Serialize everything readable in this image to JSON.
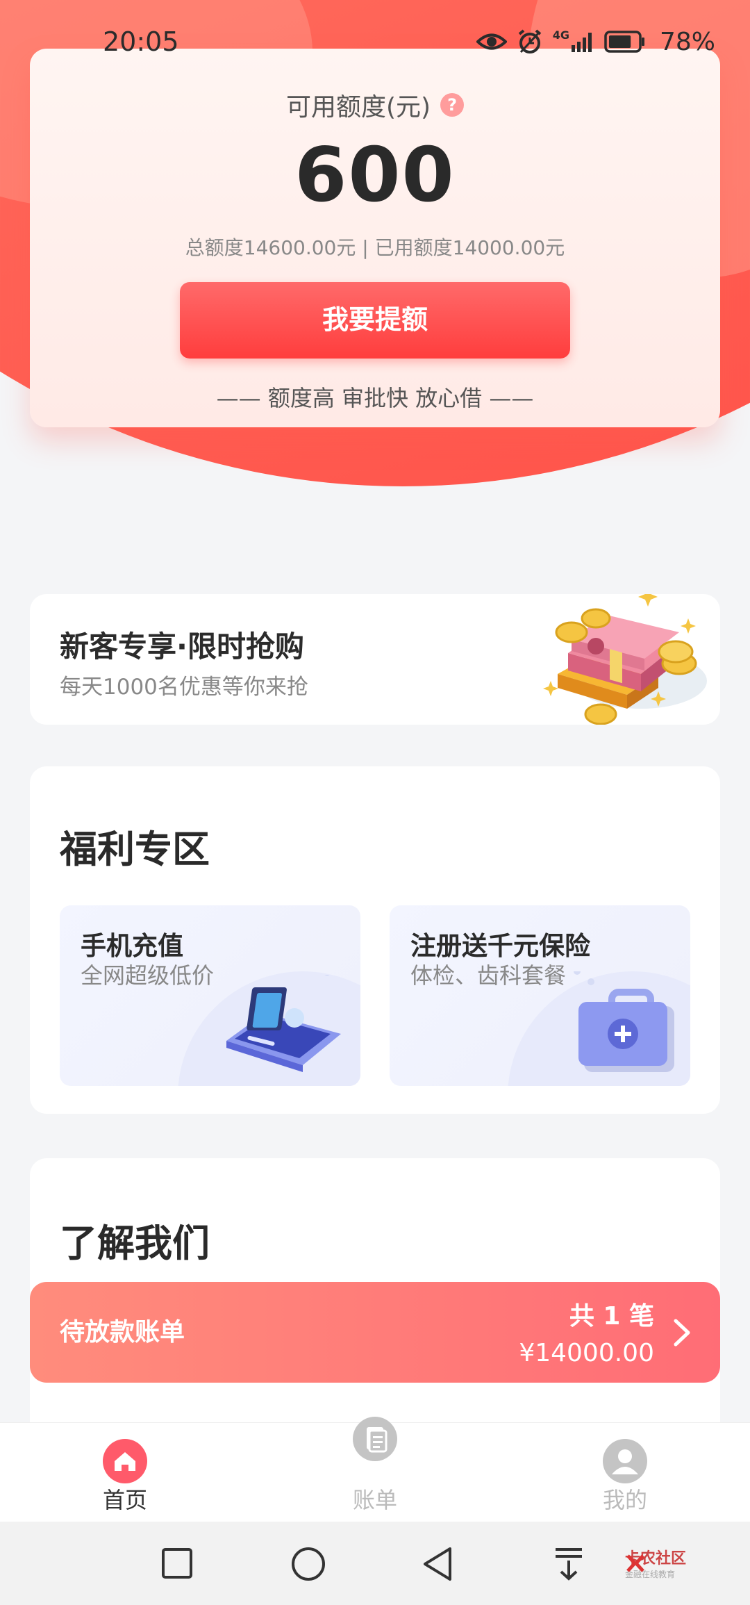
{
  "status_bar": {
    "time": "20:05",
    "network": "4G",
    "battery_percent": "78%",
    "battery_level": 0.78
  },
  "credit": {
    "title": "可用额度(元)",
    "help_icon": "question-icon",
    "amount": "600",
    "detail": "总额度14600.00元 | 已用额度14000.00元",
    "button_label": "我要提额",
    "slogan": "—— 额度高 审批快 放心借 ——"
  },
  "promo": {
    "title": "新客专享·限时抢购",
    "subtitle": "每天1000名优惠等你来抢",
    "illustration": "money-stack-illustration"
  },
  "welfare": {
    "title": "福利专区",
    "items": [
      {
        "title": "手机充值",
        "subtitle": "全网超级低价",
        "icon": "phone-card-illustration"
      },
      {
        "title": "注册送千元保险",
        "subtitle": "体检、齿科套餐",
        "icon": "medical-kit-illustration"
      }
    ]
  },
  "about": {
    "title": "了解我们"
  },
  "pending_bill": {
    "label": "待放款账单",
    "count": "共 1 笔",
    "amount": "¥14000.00"
  },
  "bottom_nav": {
    "items": [
      {
        "label": "首页",
        "icon": "home-icon",
        "active": true
      },
      {
        "label": "账单",
        "icon": "bill-icon",
        "active": false
      },
      {
        "label": "我的",
        "icon": "user-icon",
        "active": false
      }
    ]
  },
  "watermark": {
    "main": "卡农社区",
    "sub": "金融在线教育"
  },
  "colors": {
    "accent": "#ff4a4a",
    "hero": "#ff6a5c",
    "nav_active": "#ff5a5a",
    "nav_inactive": "#bfbfbf"
  }
}
